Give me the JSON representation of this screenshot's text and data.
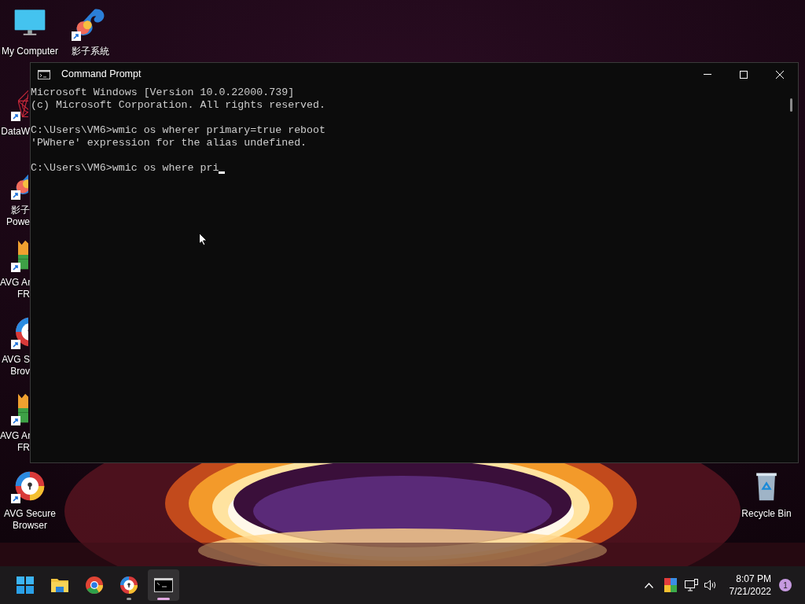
{
  "desktop_icons": [
    {
      "kind": "monitor",
      "lines": [
        "My Computer"
      ],
      "shortcut": false
    },
    {
      "kind": "swirl",
      "lines": [
        "影子系統"
      ],
      "shortcut": true
    },
    {
      "kind": "network",
      "lines": [
        "DataW"
      ],
      "shortcut": true
    },
    {
      "kind": "swirl",
      "lines": [
        "影子",
        "Powe"
      ],
      "shortcut": true
    },
    {
      "kind": "shield",
      "lines": [
        "AVG Ar",
        "FR"
      ],
      "shortcut": true
    },
    {
      "kind": "browser",
      "lines": [
        "AVG S",
        "Brov"
      ],
      "shortcut": true
    },
    {
      "kind": "shield",
      "lines": [
        "AVG Ar",
        "FR"
      ],
      "shortcut": true
    },
    {
      "kind": "browser",
      "lines": [
        "AVG Secure",
        "Browser"
      ],
      "shortcut": true
    },
    {
      "kind": "bin",
      "lines": [
        "Recycle Bin"
      ],
      "shortcut": false
    }
  ],
  "window": {
    "title": "Command Prompt",
    "console_blocks": [
      [
        "Microsoft Windows [Version 10.0.22000.739]",
        "(c) Microsoft Corporation. All rights reserved."
      ],
      [
        "C:\\Users\\VM6>wmic os wherer primary=true reboot",
        "'PWhere' expression for the alias undefined."
      ],
      [
        "C:\\Users\\VM6>wmic os where pri"
      ]
    ],
    "cursor": true
  },
  "taskbar": {
    "apps": [
      {
        "kind": "start",
        "running": false,
        "active": false
      },
      {
        "kind": "folder",
        "running": false,
        "active": false
      },
      {
        "kind": "chrome",
        "running": false,
        "active": false
      },
      {
        "kind": "browser",
        "running": true,
        "active": false
      },
      {
        "kind": "terminal",
        "running": true,
        "active": true
      }
    ],
    "time": "8:07 PM",
    "date": "7/21/2022",
    "notifications": "1"
  }
}
